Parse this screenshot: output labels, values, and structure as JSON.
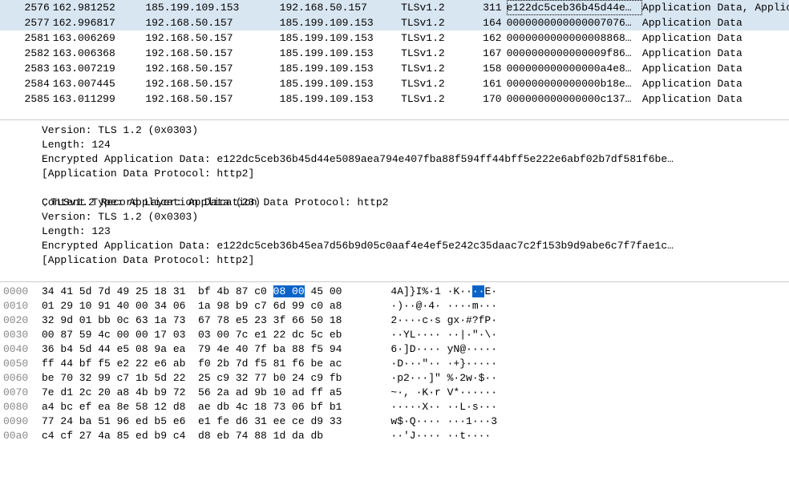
{
  "packets": [
    {
      "no": "2576",
      "time": "162.981252",
      "src": "185.199.109.153",
      "dst": "192.168.50.157",
      "proto": "TLSv1.2",
      "len": "311",
      "info1": "e122dc5ceb36b45d44e…",
      "info2": "Application Data, Applic",
      "selected": true,
      "info1_selected": true
    },
    {
      "no": "2577",
      "time": "162.996817",
      "src": "192.168.50.157",
      "dst": "185.199.109.153",
      "proto": "TLSv1.2",
      "len": "164",
      "info1": "0000000000000007076…",
      "info2": "Application Data",
      "selected": true
    },
    {
      "no": "2581",
      "time": "163.006269",
      "src": "192.168.50.157",
      "dst": "185.199.109.153",
      "proto": "TLSv1.2",
      "len": "162",
      "info1": "0000000000000008868…",
      "info2": "Application Data"
    },
    {
      "no": "2582",
      "time": "163.006368",
      "src": "192.168.50.157",
      "dst": "185.199.109.153",
      "proto": "TLSv1.2",
      "len": "167",
      "info1": "0000000000000009f86…",
      "info2": "Application Data"
    },
    {
      "no": "2583",
      "time": "163.007219",
      "src": "192.168.50.157",
      "dst": "185.199.109.153",
      "proto": "TLSv1.2",
      "len": "158",
      "info1": "000000000000000a4e8…",
      "info2": "Application Data"
    },
    {
      "no": "2584",
      "time": "163.007445",
      "src": "192.168.50.157",
      "dst": "185.199.109.153",
      "proto": "TLSv1.2",
      "len": "161",
      "info1": "000000000000000b18e…",
      "info2": "Application Data"
    },
    {
      "no": "2585",
      "time": "163.011299",
      "src": "192.168.50.157",
      "dst": "185.199.109.153",
      "proto": "TLSv1.2",
      "len": "170",
      "info1": "000000000000000c137…",
      "info2": "Application Data"
    }
  ],
  "details": {
    "l1": "Version: TLS 1.2 (0x0303)",
    "l2": "Length: 124",
    "l3": "Encrypted Application Data: e122dc5ceb36b45d44e5089aea794e407fba88f594ff44bff5e222e6abf02b7df581f6be…",
    "l4": "[Application Data Protocol: http2]",
    "hdr": "TLSv1.2 Record Layer: Application Data Protocol: http2",
    "l6": "Content Type: Application Data (23)",
    "l7": "Version: TLS 1.2 (0x0303)",
    "l8": "Length: 123",
    "l9": "Encrypted Application Data: e122dc5ceb36b45ea7d56b9d05c0aaf4e4ef5e242c35daac7c2f153b9d9abe6c7f7fae1c…",
    "l10": "[Application Data Protocol: http2]"
  },
  "hex": [
    {
      "off": "0000",
      "b1": "34 41 5d 7d 49 25 18 31",
      "b2": "bf 4b 87 c0 ",
      "bsel": "08 00",
      "b3": " 45 00",
      "ascii": "   4A]}I%·1 ·K··",
      "asel": "··",
      "a2": "E·"
    },
    {
      "off": "0010",
      "b": "01 29 10 91 40 00 34 06  1a 98 b9 c7 6d 99 c0 a8",
      "ascii": "   ·)··@·4· ····m··· "
    },
    {
      "off": "0020",
      "b": "32 9d 01 bb 0c 63 1a 73  67 78 e5 23 3f 66 50 18",
      "ascii": "   2····c·s gx·#?fP· "
    },
    {
      "off": "0030",
      "b": "00 87 59 4c 00 00 17 03  03 00 7c e1 22 dc 5c eb",
      "ascii": "   ··YL···· ··|·\"·\\· "
    },
    {
      "off": "0040",
      "b": "36 b4 5d 44 e5 08 9a ea  79 4e 40 7f ba 88 f5 94",
      "ascii": "   6·]D···· yN@····· "
    },
    {
      "off": "0050",
      "b": "ff 44 bf f5 e2 22 e6 ab  f0 2b 7d f5 81 f6 be ac",
      "ascii": "   ·D···\"·· ·+}····· "
    },
    {
      "off": "0060",
      "b": "be 70 32 99 c7 1b 5d 22  25 c9 32 77 b0 24 c9 fb",
      "ascii": "   ·p2···]\" %·2w·$·· "
    },
    {
      "off": "0070",
      "b": "7e d1 2c 20 a8 4b b9 72  56 2a ad 9b 10 ad ff a5",
      "ascii": "   ~·, ·K·r V*······ "
    },
    {
      "off": "0080",
      "b": "a4 bc ef ea 8e 58 12 d8  ae db 4c 18 73 06 bf b1",
      "ascii": "   ·····X·· ··L·s··· "
    },
    {
      "off": "0090",
      "b": "77 24 ba 51 96 ed b5 e6  e1 fe d6 31 ee ce d9 33",
      "ascii": "   w$·Q···· ···1···3 "
    },
    {
      "off": "00a0",
      "b": "c4 cf 27 4a 85 ed b9 c4  d8 eb 74 88 1d da db   ",
      "ascii": "   ··'J···· ··t····  "
    }
  ]
}
